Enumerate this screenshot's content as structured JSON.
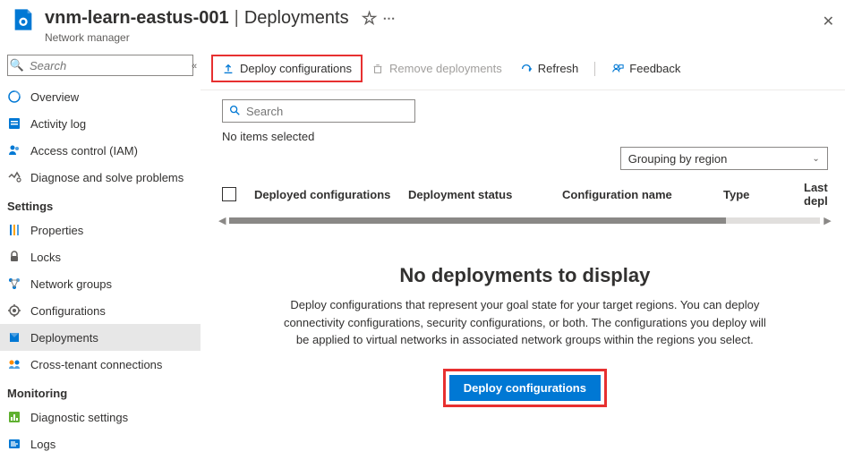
{
  "header": {
    "resource_name": "vnm-learn-eastus-001",
    "section": "Deployments",
    "subtitle": "Network manager"
  },
  "sidebar": {
    "search_placeholder": "Search",
    "items_top": [
      {
        "label": "Overview",
        "icon": "overview"
      },
      {
        "label": "Activity log",
        "icon": "activitylog"
      },
      {
        "label": "Access control (IAM)",
        "icon": "iam"
      },
      {
        "label": "Diagnose and solve problems",
        "icon": "diagnose"
      }
    ],
    "section_settings": "Settings",
    "items_settings": [
      {
        "label": "Properties",
        "icon": "properties"
      },
      {
        "label": "Locks",
        "icon": "locks"
      },
      {
        "label": "Network groups",
        "icon": "networkgroups"
      },
      {
        "label": "Configurations",
        "icon": "configurations"
      },
      {
        "label": "Deployments",
        "icon": "deployments",
        "active": true
      },
      {
        "label": "Cross-tenant connections",
        "icon": "crosstenant"
      }
    ],
    "section_monitoring": "Monitoring",
    "items_monitoring": [
      {
        "label": "Diagnostic settings",
        "icon": "diagnosticsettings"
      },
      {
        "label": "Logs",
        "icon": "logs"
      }
    ]
  },
  "toolbar": {
    "deploy": "Deploy configurations",
    "remove": "Remove deployments",
    "refresh": "Refresh",
    "feedback": "Feedback"
  },
  "filters": {
    "search_placeholder": "Search",
    "status": "No items selected",
    "grouping": "Grouping by region"
  },
  "table": {
    "columns": [
      "Deployed configurations",
      "Deployment status",
      "Configuration name",
      "Type",
      "Last depl"
    ]
  },
  "empty": {
    "title": "No deployments to display",
    "desc": "Deploy configurations that represent your goal state for your target regions. You can deploy connectivity configurations, security configurations, or both. The configurations you deploy will be applied to virtual networks in associated network groups within the regions you select.",
    "button": "Deploy configurations"
  }
}
